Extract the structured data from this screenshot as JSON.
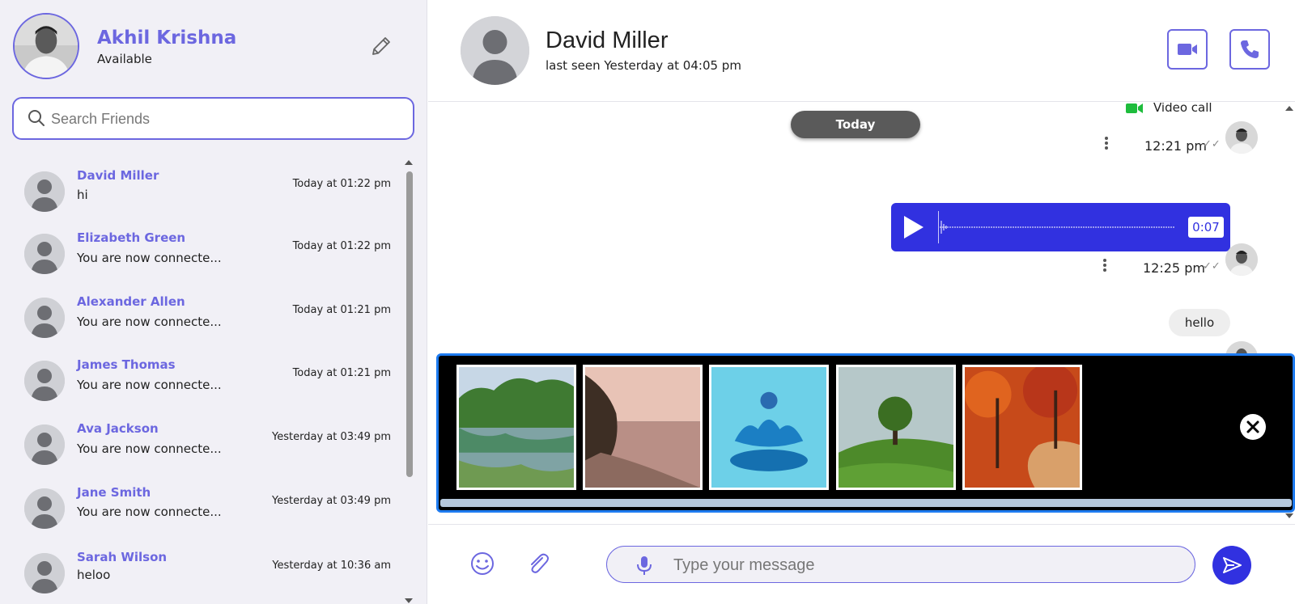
{
  "colors": {
    "accent": "#6c67e0",
    "brand_blue": "#3131e0",
    "preview_border": "#1e7bf0",
    "video_green": "#1ebc3c"
  },
  "me": {
    "name": "Akhil Krishna",
    "status": "Available",
    "edit_icon": "pencil-icon"
  },
  "search": {
    "placeholder": "Search Friends"
  },
  "contacts": [
    {
      "name": "David Miller",
      "last_message": "hi",
      "time": "Today at 01:22 pm"
    },
    {
      "name": "Elizabeth Green",
      "last_message": "You are now connecte...",
      "time": "Today at 01:22 pm"
    },
    {
      "name": "Alexander Allen",
      "last_message": "You are now connecte...",
      "time": "Today at 01:21 pm"
    },
    {
      "name": "James Thomas",
      "last_message": "You are now connecte...",
      "time": "Today at 01:21 pm"
    },
    {
      "name": "Ava Jackson",
      "last_message": "You are now connecte...",
      "time": "Yesterday at 03:49 pm"
    },
    {
      "name": "Jane Smith",
      "last_message": "You are now connecte...",
      "time": "Yesterday at 03:49 pm"
    },
    {
      "name": "Sarah Wilson",
      "last_message": "heloo",
      "time": "Yesterday at 10:36 am"
    }
  ],
  "chat": {
    "name": "David Miller",
    "last_seen": "last seen Yesterday at 04:05 pm",
    "video_call_icon": "video-camera-icon",
    "voice_call_icon": "phone-icon"
  },
  "messages": {
    "day_label": "Today",
    "items": [
      {
        "type": "call",
        "label": "Video call",
        "time": "12:21 pm",
        "ticks": "✓✓"
      },
      {
        "type": "audio",
        "duration": "0:07",
        "time": "12:25 pm",
        "ticks": "✓✓"
      },
      {
        "type": "text",
        "text": "hello"
      }
    ]
  },
  "preview": {
    "images": [
      "lake-forest-photo",
      "sunset-beach-photo",
      "water-splash-globe-photo",
      "green-hill-tree-photo",
      "autumn-path-photo"
    ],
    "close_icon": "close-icon"
  },
  "composer": {
    "placeholder": "Type your message",
    "emoji_icon": "emoji-icon",
    "attach_icon": "paperclip-icon",
    "mic_icon": "microphone-icon",
    "send_icon": "send-icon"
  }
}
